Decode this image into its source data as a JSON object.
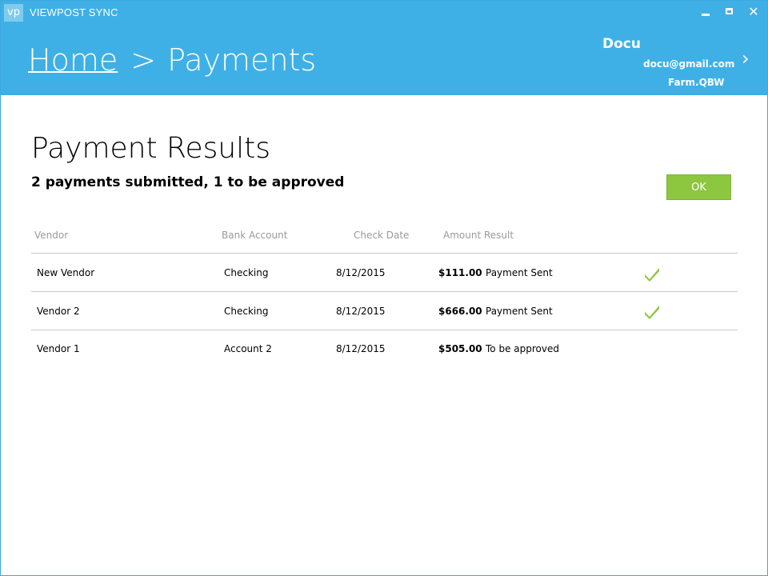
{
  "window": {
    "logo": "vp",
    "title": "VIEWPOST SYNC",
    "close_glyph": "✕"
  },
  "breadcrumb": {
    "home": "Home",
    "separator": ">",
    "current": "Payments"
  },
  "user": {
    "name": "Docu",
    "email": "docu@gmail.com",
    "company_file": "Farm.QBW",
    "chevron": "›"
  },
  "page": {
    "title": "Payment Results",
    "subtitle": "2 payments submitted, 1 to be approved",
    "ok_label": "OK"
  },
  "table": {
    "headers": {
      "vendor": "Vendor",
      "bank_account": "Bank Account",
      "check_date": "Check Date",
      "amount_result": "Amount Result"
    },
    "rows": [
      {
        "vendor": "New Vendor",
        "bank_account": "Checking",
        "check_date": "8/12/2015",
        "amount": "$111.00",
        "result": "Payment Sent",
        "status_icon": "check-icon"
      },
      {
        "vendor": "Vendor 2",
        "bank_account": "Checking",
        "check_date": "8/12/2015",
        "amount": "$666.00",
        "result": "Payment Sent",
        "status_icon": "check-icon"
      },
      {
        "vendor": "Vendor 1",
        "bank_account": "Account 2",
        "check_date": "8/12/2015",
        "amount": "$505.00",
        "result": "To be approved",
        "status_icon": ""
      }
    ]
  },
  "colors": {
    "header_blue": "#3fb0e6",
    "ok_green": "#8dc63f",
    "check_green": "#8dc63f"
  }
}
